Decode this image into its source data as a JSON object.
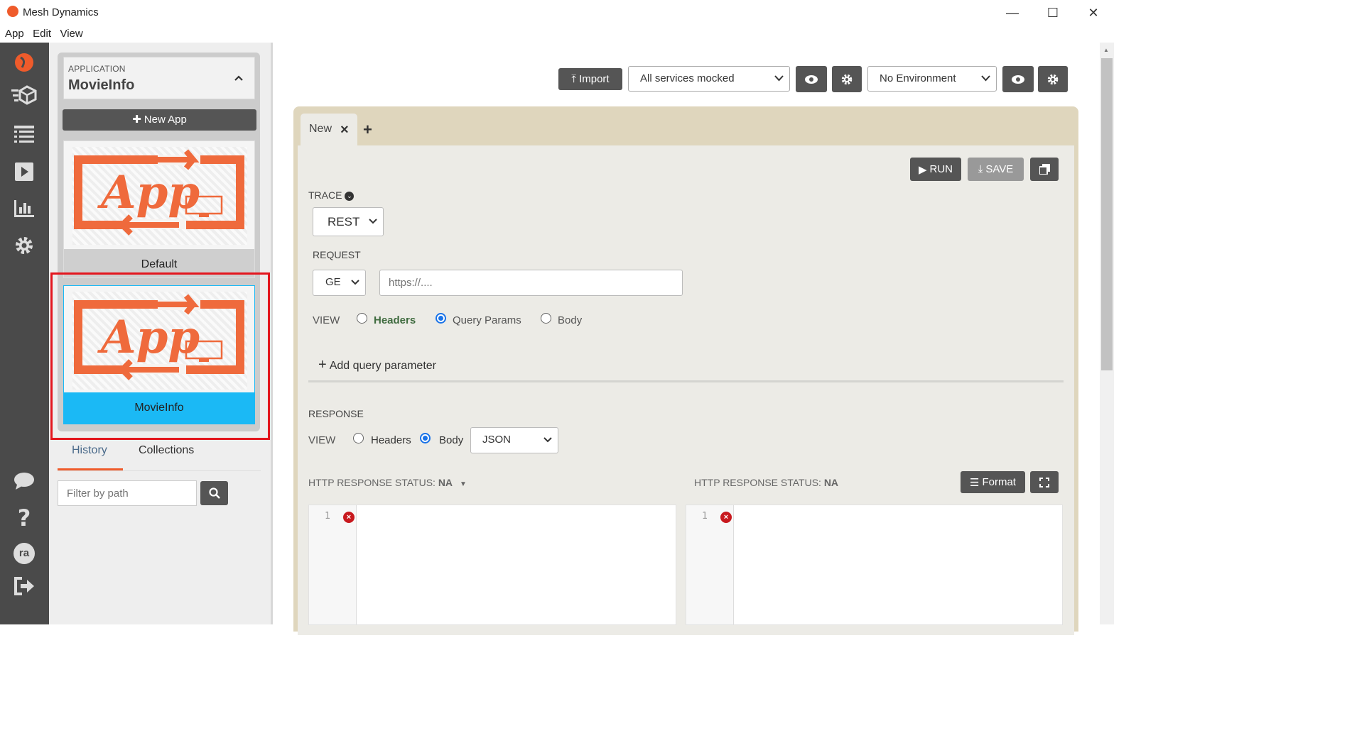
{
  "window": {
    "title": "Mesh Dynamics",
    "minimize": "—",
    "maximize": "☐",
    "close": "✕"
  },
  "menu": {
    "items": [
      "App",
      "Edit",
      "View"
    ]
  },
  "sidebar": {
    "app_label": "APPLICATION",
    "app_value": "MovieInfo",
    "new_app_label": "New App",
    "cards": [
      {
        "name": "Default"
      },
      {
        "name": "MovieInfo"
      }
    ],
    "card_art_text": "App",
    "tabs": [
      "History",
      "Collections"
    ],
    "filter_placeholder": "Filter by path"
  },
  "toolbar": {
    "import_label": "Import",
    "mock_select": "All services mocked",
    "env_select": "No Environment"
  },
  "editor_tab": {
    "label": "New",
    "close": "×",
    "add": "+"
  },
  "actions": {
    "run_label": "RUN",
    "save_label": "SAVE"
  },
  "trace": {
    "label": "TRACE",
    "value": "REST"
  },
  "request": {
    "label": "REQUEST",
    "method": "GE",
    "url_placeholder": "https://....",
    "view_label": "VIEW",
    "view_options": [
      "Headers",
      "Query Params",
      "Body"
    ],
    "selected_view": "Query Params",
    "add_param_label": "Add query parameter"
  },
  "response": {
    "label": "RESPONSE",
    "view_label": "VIEW",
    "view_options": [
      "Headers",
      "Body"
    ],
    "selected_view": "Body",
    "format_value": "JSON",
    "status_prefix": "HTTP RESPONSE STATUS:",
    "status_left": "NA",
    "status_right": "NA",
    "format_button": "Format",
    "line_number": "1"
  },
  "colors": {
    "accent": "#ef5b2b",
    "selected_card": "#1bb9f5",
    "highlight": "#e3161e",
    "nav_bg": "#4a4a4a",
    "work_bg": "#dfd6bd"
  },
  "icons": [
    "logo-icon",
    "cube-icon",
    "list-icon",
    "play-icon",
    "chart-icon",
    "gear-icon",
    "chat-icon",
    "help-icon",
    "avatar",
    "logout-icon"
  ],
  "user_initials": "ra"
}
